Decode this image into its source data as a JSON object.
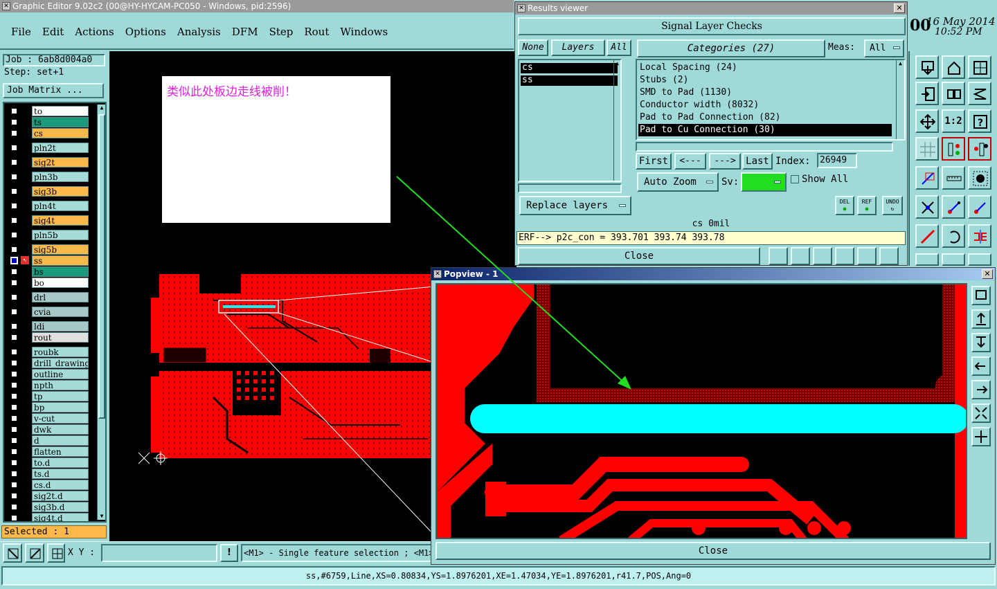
{
  "main_window": {
    "title": "Graphic Editor 9.02c2 (00@HY-HYCAM-PC050 - Windows, pid:2596)",
    "menu": [
      "File",
      "Edit",
      "Actions",
      "Options",
      "Analysis",
      "DFM",
      "Step",
      "Rout",
      "Windows"
    ]
  },
  "job": {
    "job_label": "Job : 6ab8d004a0",
    "step_label": "Step: set+1",
    "matrix_button": "Job Matrix ..."
  },
  "layers": [
    {
      "name": "to",
      "color": "#ffffff"
    },
    {
      "name": "ts",
      "color": "#1a9a7a"
    },
    {
      "name": "cs",
      "color": "#ffb84a"
    },
    {
      "name": "pln2t",
      "color": "#a6dcd8"
    },
    {
      "name": "sig2t",
      "color": "#ffb84a"
    },
    {
      "name": "pln3b",
      "color": "#a6dcd8"
    },
    {
      "name": "sig3b",
      "color": "#ffb84a"
    },
    {
      "name": "pln4t",
      "color": "#a6dcd8"
    },
    {
      "name": "sig4t",
      "color": "#ffb84a"
    },
    {
      "name": "pln5b",
      "color": "#a6dcd8"
    },
    {
      "name": "sig5b",
      "color": "#ffb84a"
    },
    {
      "name": "ss",
      "color": "#ffb84a"
    },
    {
      "name": "bs",
      "color": "#1a9a7a"
    },
    {
      "name": "bo",
      "color": "#ffffff"
    },
    {
      "name": "drl",
      "color": "#a8c8c8"
    },
    {
      "name": "cvia",
      "color": "#a8c8c8"
    },
    {
      "name": "ldi",
      "color": "#a8c8c8"
    },
    {
      "name": "rout",
      "color": "#e0e0e0"
    },
    {
      "name": "roubk",
      "color": "#a6dcd8"
    },
    {
      "name": "drill_drawing",
      "color": "#a6dcd8"
    },
    {
      "name": "outline",
      "color": "#a6dcd8"
    },
    {
      "name": "npth",
      "color": "#a6dcd8"
    },
    {
      "name": "tp",
      "color": "#a6dcd8"
    },
    {
      "name": "bp",
      "color": "#a6dcd8"
    },
    {
      "name": "v-cut",
      "color": "#a6dcd8"
    },
    {
      "name": "dwk",
      "color": "#a6dcd8"
    },
    {
      "name": "d",
      "color": "#a6dcd8"
    },
    {
      "name": "flatten",
      "color": "#a6dcd8"
    },
    {
      "name": "to.d",
      "color": "#a6dcd8"
    },
    {
      "name": "ts.d",
      "color": "#a6dcd8"
    },
    {
      "name": "cs.d",
      "color": "#a6dcd8"
    },
    {
      "name": "sig2t.d",
      "color": "#a6dcd8"
    },
    {
      "name": "sig3b.d",
      "color": "#a6dcd8"
    },
    {
      "name": "sig4t.d",
      "color": "#a6dcd8"
    }
  ],
  "selected_label": "Selected : 1",
  "note_text": "类似此处板边走线被削！",
  "clock": {
    "date": "16 May 2014",
    "time": "10:52 PM",
    "partial": "00"
  },
  "results_viewer": {
    "title": "Results viewer",
    "header": "Signal Layer Checks",
    "none_btn": "None",
    "layers_btn": "Layers",
    "all_btn": "All",
    "categories_btn": "Categories (27)",
    "meas_label": "Meas:",
    "meas_value": "All",
    "layer_list": [
      "cs",
      "ss"
    ],
    "categories": [
      "Local Spacing (24)",
      "Stubs (2)",
      "SMD to Pad (1130)",
      "Conductor width (8032)",
      "Pad to Pad Connection (82)",
      "Pad to Cu Connection (30)"
    ],
    "first_btn": "First",
    "prev_btn": "<---",
    "next_btn": "--->",
    "last_btn": "Last",
    "index_label": "Index:",
    "index_value": "26949",
    "auto_zoom": "Auto Zoom",
    "sv_label": "Sv:",
    "show_all": "Show All",
    "replace_layers": "Replace layers",
    "del_btn": "DEL",
    "ref_btn": "REF",
    "undo_btn": "UNDO",
    "status": "cs 0mil",
    "erf_line": "ERF--> p2c_con = 393.701 393.74 393.78",
    "close": "Close"
  },
  "popview": {
    "title": "Popview - 1",
    "close": "Close"
  },
  "bottom": {
    "xy_label": "X Y :",
    "xy_value": "",
    "hint": "<M1> - Single feature selection ; <M1><",
    "feature_info": "ss,#6759,Line,XS=0.80834,YS=1.8976201,XE=1.47034,YE=1.8976201,r41.7,POS,Ang=0"
  },
  "colors": {
    "accent": "#9fdad9",
    "copper": "#ff0000",
    "highlight": "#00ffff",
    "arrow": "#22dd22"
  }
}
